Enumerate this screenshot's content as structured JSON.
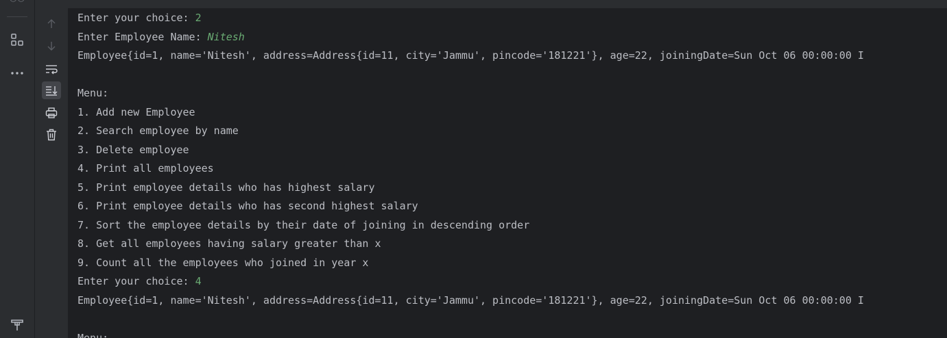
{
  "console": {
    "lines": [
      {
        "text": "Enter your choice: ",
        "input": "2"
      },
      {
        "text": "Enter Employee Name: ",
        "input": "Nitesh"
      },
      {
        "text": "Employee{id=1, name='Nitesh', address=Address{id=11, city='Jammu', pincode='181221'}, age=22, joiningDate=Sun Oct 06 00:00:00 I"
      },
      {
        "text": ""
      },
      {
        "text": "Menu:"
      },
      {
        "text": "1. Add new Employee"
      },
      {
        "text": "2. Search employee by name"
      },
      {
        "text": "3. Delete employee"
      },
      {
        "text": "4. Print all employees"
      },
      {
        "text": "5. Print employee details who has highest salary"
      },
      {
        "text": "6. Print employee details who has second highest salary"
      },
      {
        "text": "7. Sort the employee details by their date of joining in descending order"
      },
      {
        "text": "8. Get all employees having salary greater than x"
      },
      {
        "text": "9. Count all the employees who joined in year x"
      },
      {
        "text": "Enter your choice: ",
        "input": "4"
      },
      {
        "text": "Employee{id=1, name='Nitesh', address=Address{id=11, city='Jammu', pincode='181221'}, age=22, joiningDate=Sun Oct 06 00:00:00 I"
      },
      {
        "text": ""
      },
      {
        "text": "Menu:"
      }
    ]
  },
  "left_strip": {
    "icons": [
      "structure-icon",
      "more-icon",
      "build-icon"
    ]
  },
  "toolbar": {
    "icons": [
      "scroll-up-icon",
      "scroll-down-icon",
      "soft-wrap-icon",
      "scroll-to-end-icon",
      "print-icon",
      "clear-all-icon"
    ]
  },
  "colors": {
    "background": "#1e1f22",
    "panel": "#2b2d30",
    "text": "#bcbec4",
    "user_input": "#6aab73"
  }
}
